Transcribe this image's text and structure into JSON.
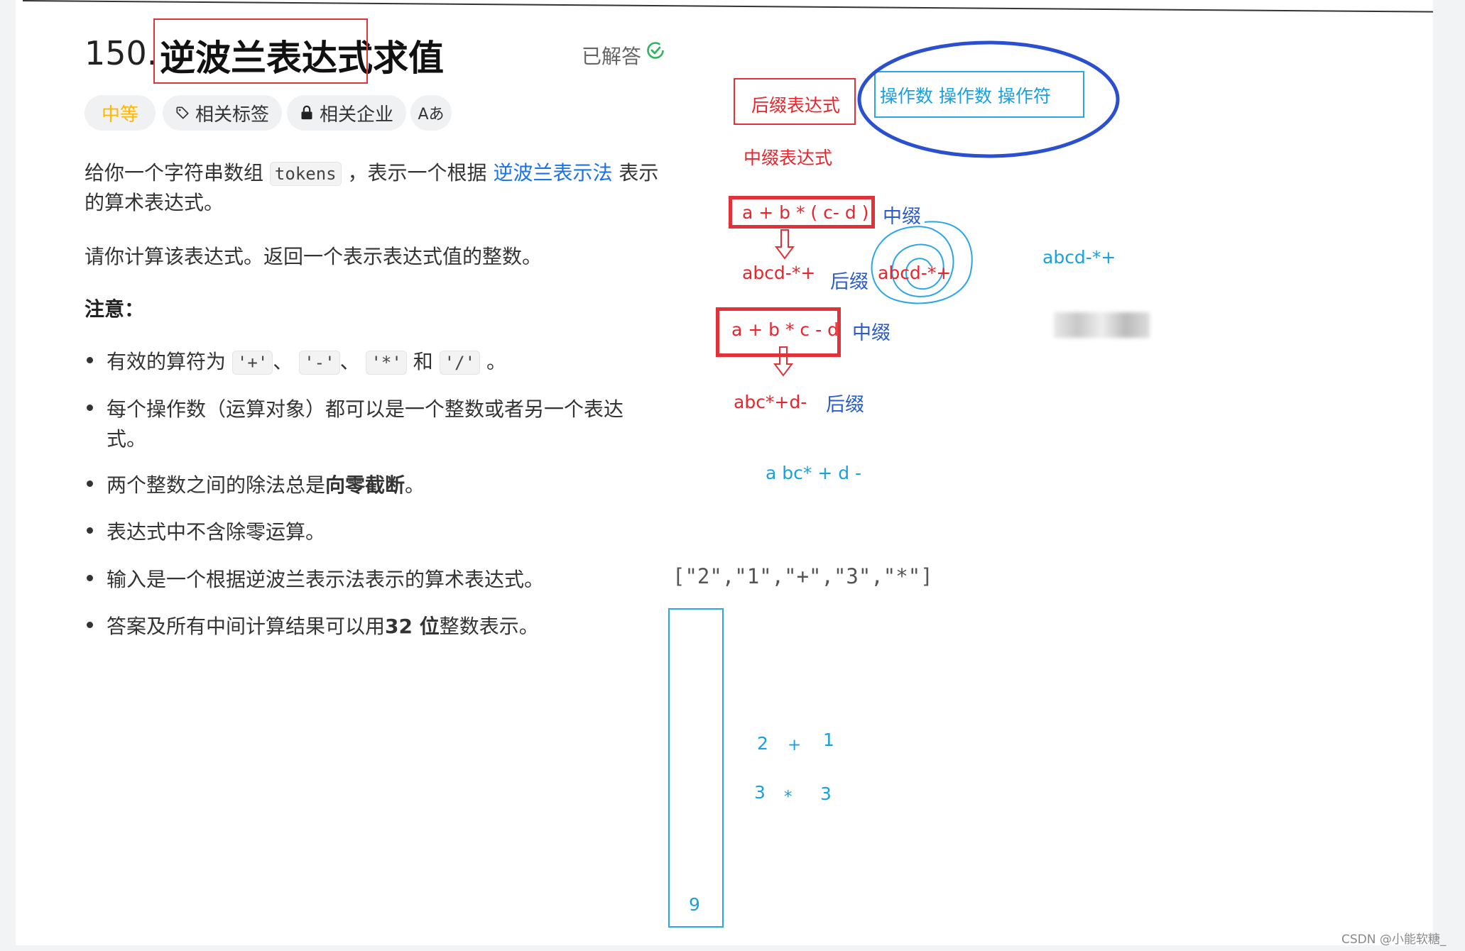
{
  "problem": {
    "number": "150.",
    "title": "逆波兰表达式求值",
    "status": "已解答"
  },
  "tags": {
    "difficulty": "中等",
    "related_tags": "相关标签",
    "related_companies": "相关企业",
    "translate": "Aあ"
  },
  "description": {
    "p1_a": "给你一个字符串数组",
    "p1_code": "tokens",
    "p1_b": "，表示一个根据",
    "p1_link": "逆波兰表示法",
    "p1_c": "表示",
    "p1_line2": "的算术表达式。",
    "p2": "请你计算该表达式。返回一个表示表达式值的整数。",
    "note_title": "注意：",
    "notes": [
      {
        "a": "有效的算符为",
        "c1": "'+'",
        "s1": "、",
        "c2": "'-'",
        "s2": "、",
        "c3": "'*'",
        "s3": "和",
        "c4": "'/'",
        "end": "。"
      },
      {
        "line1": "每个操作数（运算对象）都可以是一个整数或者另一个表达",
        "line2": "式。"
      },
      {
        "a": "两个整数之间的除法总是",
        "b": "向零截断",
        "c": "。"
      },
      {
        "a": "表达式中不含除零运算。"
      },
      {
        "a": "输入是一个根据逆波兰表示法表示的算术表达式。"
      },
      {
        "a": "答案及所有中间计算结果可以用",
        "b": "32 位",
        "c": "整数表示。"
      }
    ]
  },
  "annotations": {
    "postfix_box": "后缀表达式",
    "operands_box": "操作数 操作数 操作符",
    "infix_label": "中缀表达式",
    "expr1": "a + b * ( c- d )",
    "expr1_tag": "中缀",
    "postfix1": "abcd-*+",
    "postfix1_tag": "后缀",
    "postfix1_circled": "abcd-*+",
    "postfix1_right": "abcd-*+",
    "expr2": "a + b * c - d",
    "expr2_tag": "中缀",
    "postfix2": "abc*+d-",
    "postfix2_tag": "后缀",
    "postfix2_spaced": "a bc* + d -",
    "tokens_example": "[\"2\",\"1\",\"+\",\"3\",\"*\"]",
    "stack_result": "9",
    "calc": [
      "2",
      "+",
      "1",
      "3",
      "*",
      "3"
    ]
  },
  "watermark": "CSDN @小能软糖_",
  "colors": {
    "annotation_red": "#e8252c",
    "annotation_blue": "#2b5ccf",
    "annotation_cyan": "#18a0e0",
    "difficulty": "#ffb800",
    "link": "#1a73e8",
    "solved_green": "#2db55d"
  }
}
